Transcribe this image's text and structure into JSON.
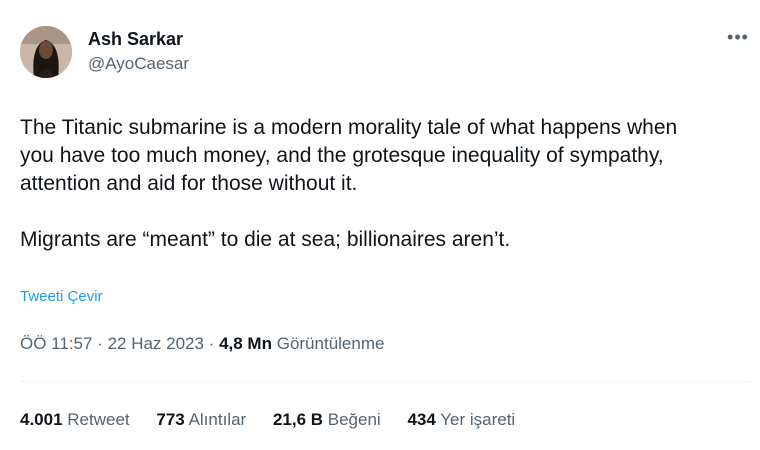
{
  "author": {
    "display_name": "Ash Sarkar",
    "handle": "@AyoCaesar"
  },
  "more_icon": "more-horizontal-icon",
  "tweet": {
    "paragraphs": [
      "The Titanic submarine is a modern morality tale of what happens when\nyou have too much money, and the grotesque inequality of sympathy,\nattention and aid for those without it.",
      "Migrants are “meant” to die at sea; billionaires aren’t."
    ],
    "translate_label": "Tweeti Çevir"
  },
  "meta": {
    "time": "ÖÖ 11:57",
    "separator_1": " · ",
    "date": "22 Haz 2023",
    "separator_2": " · ",
    "views_count": "4,8 Mn",
    "views_label": "Görüntülenme"
  },
  "stats": [
    {
      "count": "4.001",
      "label": "Retweet"
    },
    {
      "count": "773",
      "label": "Alıntılar"
    },
    {
      "count": "21,6 B",
      "label": "Beğeni"
    },
    {
      "count": "434",
      "label": "Yer işareti"
    }
  ],
  "colors": {
    "text_primary": "#0f1419",
    "text_secondary": "#536471",
    "link": "#1d9bf0",
    "divider": "#eff3f4"
  }
}
